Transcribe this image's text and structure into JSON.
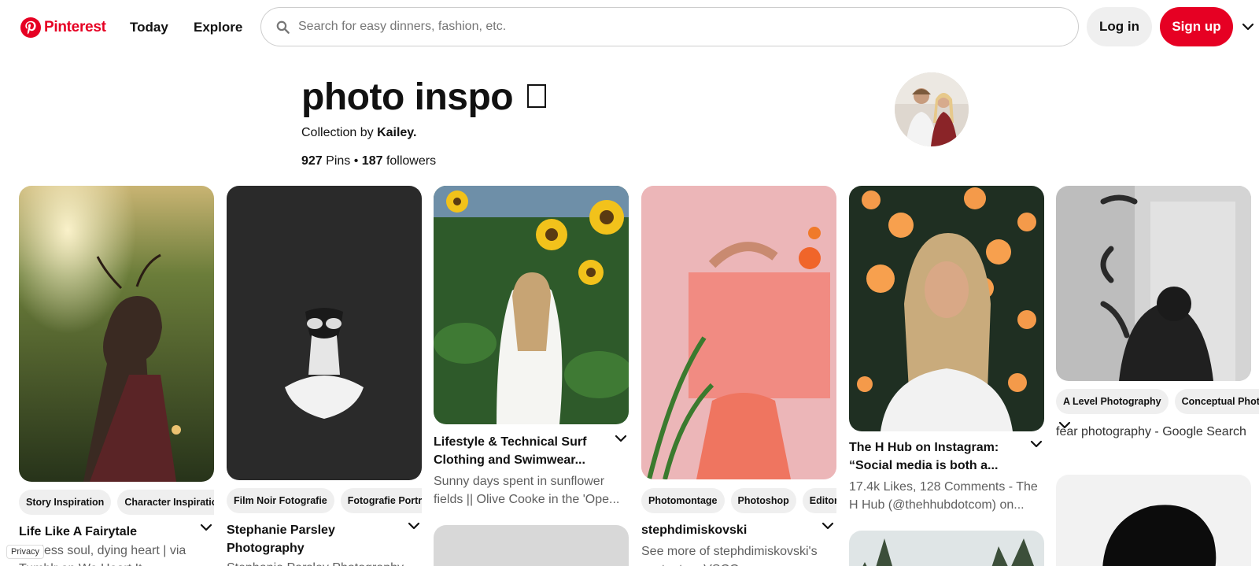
{
  "header": {
    "logo_text": "Pinterest",
    "nav": [
      {
        "label": "Today"
      },
      {
        "label": "Explore"
      }
    ],
    "search_placeholder": "Search for easy dinners, fashion, etc.",
    "login_label": "Log in",
    "signup_label": "Sign up"
  },
  "board": {
    "title": "photo inspo",
    "collection_prefix": "Collection by",
    "owner": "Kailey.",
    "pins_count": "927",
    "pins_label": "Pins",
    "separator": "•",
    "followers_count": "187",
    "followers_label": "followers"
  },
  "pins": [
    {
      "tags": [
        "Story Inspiration",
        "Character Inspiration"
      ],
      "title": "Life Like A Fairytale",
      "description": "Endless soul, dying heart | via Tumblr on We Heart It"
    },
    {
      "tags": [
        "Film Noir Fotografie",
        "Fotografie Portrait"
      ],
      "title": "Stephanie Parsley Photography",
      "description": "Stephanie Parsley Photography"
    },
    {
      "tags": [],
      "title": "Lifestyle & Technical Surf Clothing and Swimwear...",
      "description": "Sunny days spent in sunflower fields || Olive Cooke in the 'Ope..."
    },
    {
      "tags": [
        "Photomontage",
        "Photoshop",
        "Editorial"
      ],
      "title": "stephdimiskovski",
      "description": "See more of stephdimiskovski's content on VSCO."
    },
    {
      "tags": [],
      "title": "The H Hub on Instagram: “Social media is both a...",
      "description": "17.4k Likes, 128 Comments - The H Hub (@thehhubdotcom) on..."
    },
    {
      "tags": [
        "A Level Photography",
        "Conceptual Photography"
      ],
      "title": "",
      "description": "fear photography - Google Search"
    }
  ],
  "footer": {
    "privacy_label": "Privacy"
  },
  "colors": {
    "brand": "#e60023",
    "chip_bg": "#efefef",
    "muted_text": "#5f5f5f"
  }
}
